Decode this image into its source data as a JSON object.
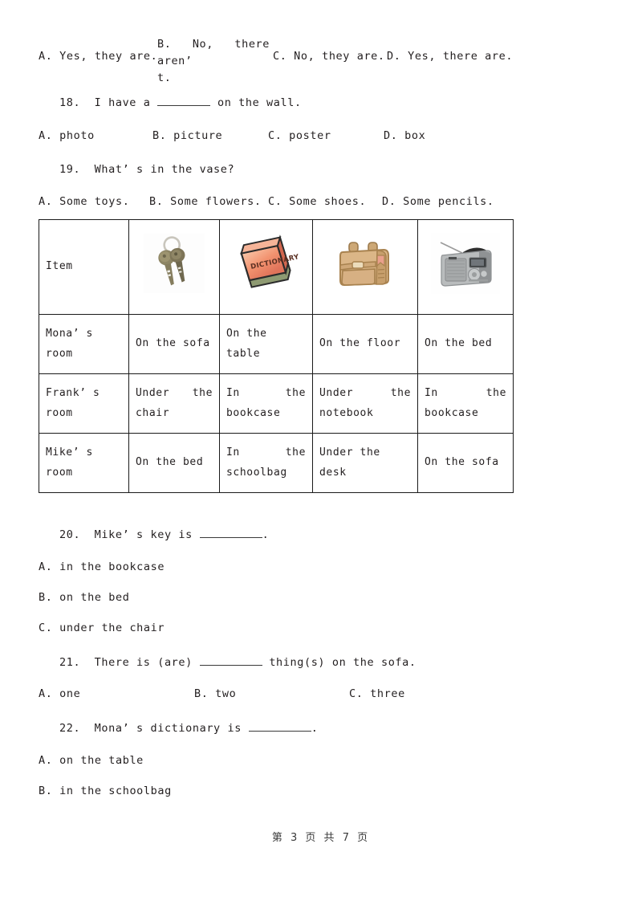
{
  "document": {
    "footer": "第 3 页 共 7 页",
    "page_number": "3",
    "total_pages": "7"
  },
  "question_17_options": {
    "a": "A. Yes, they are.",
    "b_line1": "B. No,  there  aren’",
    "b_line2": "t.",
    "c": "C. No, they are.",
    "d": "D. Yes, there are."
  },
  "question_18": {
    "number": "18",
    "separator": ".",
    "stem_before": "I have a",
    "stem_after": "on the wall.",
    "options": {
      "a": "A. photo",
      "b": "B. picture",
      "c": "C. poster",
      "d": "D. box"
    }
  },
  "question_19": {
    "number": "19",
    "separator": ".",
    "stem": "What’ s in the vase?",
    "options": {
      "a": "A. Some toys.",
      "b": "B. Some flowers.",
      "c": "C. Some shoes.",
      "d": "D. Some pencils."
    }
  },
  "table": {
    "header_label": "Item",
    "header_images": [
      {
        "name": "keys-photo",
        "alt": "keys"
      },
      {
        "name": "dictionary-book-image",
        "alt": "dictionary",
        "cover_text": "DICTIONARY"
      },
      {
        "name": "schoolbag-image",
        "alt": "schoolbag"
      },
      {
        "name": "radio-photo",
        "alt": "radio"
      }
    ],
    "rows": [
      {
        "name_line1": "Mona’ s",
        "name_line2": "room",
        "cells": [
          {
            "line1": "On the sofa",
            "line2": ""
          },
          {
            "line1": "On the table",
            "line2": ""
          },
          {
            "line1": "On the floor",
            "line2": ""
          },
          {
            "line1": "On the bed",
            "line2": ""
          }
        ]
      },
      {
        "name_line1": "Frank’ s",
        "name_line2": "room",
        "cells": [
          {
            "line1": "Under the",
            "line2": "chair"
          },
          {
            "line1": "In the",
            "line2": "bookcase"
          },
          {
            "line1": "Under the",
            "line2": "notebook"
          },
          {
            "line1": "In the",
            "line2": "bookcase"
          }
        ]
      },
      {
        "name_line1": "Mike’ s",
        "name_line2": "room",
        "cells": [
          {
            "line1": "On the bed",
            "line2": ""
          },
          {
            "line1": "In the",
            "line2": "schoolbag"
          },
          {
            "line1": "Under the desk",
            "line2": ""
          },
          {
            "line1": "On the sofa",
            "line2": ""
          }
        ]
      }
    ]
  },
  "question_20": {
    "number": "20",
    "separator": ".",
    "stem_before": "Mike’ s key is",
    "stem_after": ".",
    "options": {
      "a": "A. in the bookcase",
      "b": "B. on the bed",
      "c": "C. under the chair"
    }
  },
  "question_21": {
    "number": "21",
    "separator": ".",
    "stem_before": "There is (are)",
    "stem_after": "thing(s) on the sofa.",
    "options": {
      "a": "A. one",
      "b": "B. two",
      "c": "C. three"
    }
  },
  "question_22": {
    "number": "22",
    "separator": ".",
    "stem_before": "Mona’ s dictionary is",
    "stem_after": ".",
    "options": {
      "a": "A. on the table",
      "b": "B. in the schoolbag"
    }
  },
  "colors": {
    "text": "#231f20",
    "rule": "#1a1a1a",
    "book_cover_top": "#f7b89a",
    "book_cover_bottom": "#e8755a",
    "book_pages": "#9aa57e",
    "bag_body": "#d9b483",
    "bag_shadow": "#b98f5e",
    "radio_body": "#b9bcbd",
    "radio_dark": "#3b3b3b",
    "key_metal": "#8d8564"
  }
}
